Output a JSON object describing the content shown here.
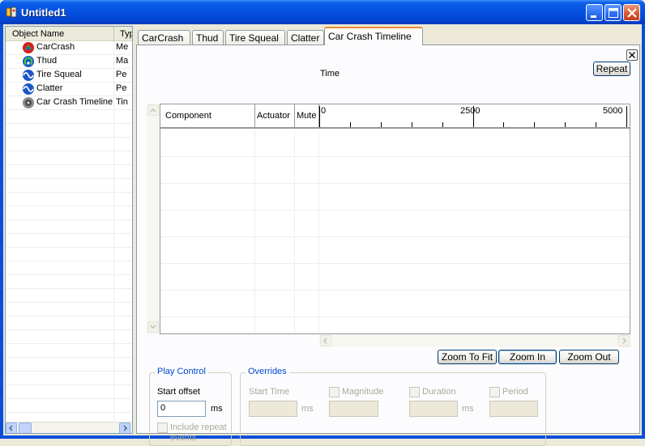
{
  "window": {
    "title": "Untitled1"
  },
  "object_list": {
    "headers": [
      "Object Name",
      "Type"
    ],
    "items": [
      {
        "name": "CarCrash",
        "type": "Me",
        "icon": "carcrash-effect-icon"
      },
      {
        "name": "Thud",
        "type": "Ma",
        "icon": "thud-effect-icon"
      },
      {
        "name": "Tire Squeal",
        "type": "Pe",
        "icon": "tire-squeal-effect-icon"
      },
      {
        "name": "Clatter",
        "type": "Pe",
        "icon": "clatter-effect-icon"
      },
      {
        "name": "Car Crash Timeline",
        "type": "Tin",
        "icon": "timeline-icon"
      }
    ]
  },
  "tabs": [
    "CarCrash",
    "Thud",
    "Tire Squeal",
    "Clatter",
    "Car Crash Timeline"
  ],
  "active_tab": "Car Crash Timeline",
  "timeline": {
    "time_label": "Time",
    "repeat_label": "Repeat",
    "columns": [
      "Component",
      "Actuator",
      "Mute"
    ],
    "ruler_labels": [
      "0",
      "2500",
      "5000"
    ],
    "rows": []
  },
  "zoom": {
    "fit": "Zoom To Fit",
    "in": "Zoom In",
    "out": "Zoom Out"
  },
  "play_control": {
    "legend": "Play Control",
    "start_offset_label": "Start offset",
    "start_offset_value": "0",
    "unit": "ms",
    "include_repeat_label_1": "Include repeat",
    "include_repeat_label_2": "events"
  },
  "overrides": {
    "legend": "Overrides",
    "start_time_label": "Start Time",
    "start_time_unit": "ms",
    "magnitude_label": "Magnitude",
    "duration_label": "Duration",
    "duration_unit": "ms",
    "period_label": "Period"
  }
}
